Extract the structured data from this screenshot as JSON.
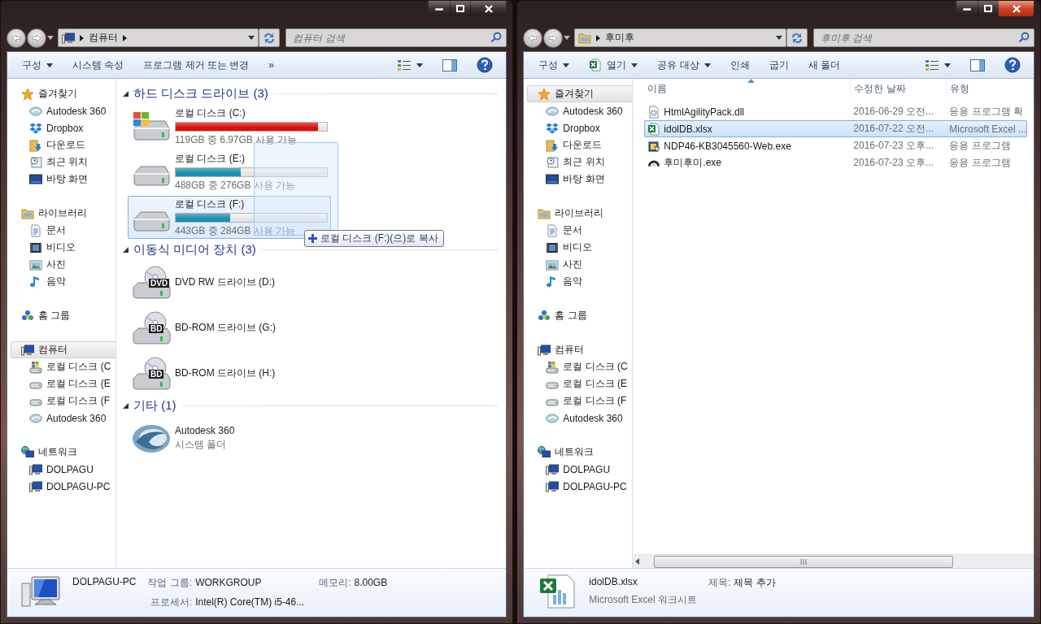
{
  "windows": [
    {
      "active": false,
      "address": {
        "kind": "computer",
        "crumbs": [
          "컴퓨터"
        ],
        "has_more": true
      },
      "search": {
        "placeholder": "컴퓨터 검색"
      },
      "toolbar": [
        {
          "label": "구성",
          "kind": "plain",
          "dropdown": true
        },
        {
          "label": "시스템 속성",
          "kind": "plain",
          "dropdown": false
        },
        {
          "label": "프로그램 제거 또는 변경",
          "kind": "plain",
          "dropdown": false
        },
        {
          "label": "»",
          "kind": "more",
          "dropdown": false
        }
      ],
      "sidebar": [
        {
          "label": "즐겨찾기",
          "kind": "favorites",
          "selected": false,
          "children": [
            {
              "label": "Autodesk 360",
              "kind": "cloud",
              "selected": false
            },
            {
              "label": "Dropbox",
              "kind": "dropbox",
              "selected": false
            },
            {
              "label": "다운로드",
              "kind": "downloads",
              "selected": false
            },
            {
              "label": "최근 위치",
              "kind": "recent",
              "selected": false
            },
            {
              "label": "바탕 화면",
              "kind": "desktop",
              "selected": false
            }
          ]
        },
        {
          "label": "라이브러리",
          "kind": "library",
          "selected": false,
          "children": [
            {
              "label": "문서",
              "kind": "documents",
              "selected": false
            },
            {
              "label": "비디오",
              "kind": "videos",
              "selected": false
            },
            {
              "label": "사진",
              "kind": "pictures",
              "selected": false
            },
            {
              "label": "음악",
              "kind": "music",
              "selected": false
            }
          ]
        },
        {
          "label": "홈 그룹",
          "kind": "homegroup",
          "selected": false
        },
        {
          "label": "컴퓨터",
          "kind": "computer",
          "selected": true,
          "children": [
            {
              "label": "로컬 디스크 (C",
              "kind": "system-drive",
              "selected": false
            },
            {
              "label": "로컬 디스크 (E",
              "kind": "drive",
              "selected": false
            },
            {
              "label": "로컬 디스크 (F",
              "kind": "drive",
              "selected": false
            },
            {
              "label": "Autodesk 360",
              "kind": "cloud",
              "selected": false
            }
          ]
        },
        {
          "label": "네트워크",
          "kind": "network",
          "selected": false,
          "children": [
            {
              "label": "DOLPAGU",
              "kind": "pc",
              "selected": false
            },
            {
              "label": "DOLPAGU-PC",
              "kind": "pc",
              "selected": false
            }
          ]
        }
      ],
      "content": {
        "kind": "drives",
        "drag_tip": "로컬 디스크 (F:)(으)로 복사",
        "groups": [
          {
            "title": "하드 디스크 드라이브 (3)",
            "expanded": true,
            "items": [
              {
                "kind": "system-drive",
                "name": "로컬 디스크 (C:)",
                "level": 0.94,
                "color": "#e00d0d",
                "space": "119GB 중 6.97GB 사용 가능",
                "selected": false
              },
              {
                "kind": "drive",
                "name": "로컬 디스크 (E:)",
                "level": 0.43,
                "color": "#1b8fae",
                "space": "488GB 중 276GB 사용 가능",
                "selected": false
              },
              {
                "kind": "drive",
                "name": "로컬 디스크 (F:)",
                "level": 0.36,
                "color": "#1b8fae",
                "space": "443GB 중 284GB 사용 가능",
                "selected": true
              }
            ]
          },
          {
            "title": "이동식 미디어 장치 (3)",
            "expanded": true,
            "items": [
              {
                "kind": "disc-drive",
                "badge": "DVD",
                "name": "DVD RW 드라이브 (D:)",
                "selected": false
              },
              {
                "kind": "disc-drive",
                "badge": "BD",
                "name": "BD-ROM 드라이브 (G:)",
                "selected": false
              },
              {
                "kind": "disc-drive",
                "badge": "BD",
                "name": "BD-ROM 드라이브 (H:)",
                "selected": false
              }
            ]
          },
          {
            "title": "기타 (1)",
            "expanded": true,
            "items": [
              {
                "kind": "cloud",
                "name": "Autodesk 360",
                "subtitle": "시스템 폴더",
                "selected": false
              }
            ]
          }
        ]
      },
      "details": {
        "kind": "computer",
        "title": "DOLPAGU-PC",
        "fields": [
          {
            "label": "작업 그룹:",
            "value": "WORKGROUP"
          },
          {
            "label": "메모리:",
            "value": "8.00GB"
          },
          {
            "label": "프로세서:",
            "value": "Intel(R) Core(TM) i5-46..."
          }
        ]
      }
    },
    {
      "active": true,
      "address": {
        "kind": "folder",
        "crumbs": [
          "후미후"
        ],
        "has_more": false
      },
      "search": {
        "placeholder": "후미후 검색"
      },
      "toolbar": [
        {
          "label": "구성",
          "kind": "plain",
          "dropdown": true
        },
        {
          "label": "열기",
          "kind": "app",
          "dropdown": true
        },
        {
          "label": "공유 대상",
          "kind": "plain",
          "dropdown": true
        },
        {
          "label": "인쇄",
          "kind": "plain",
          "dropdown": false
        },
        {
          "label": "굽기",
          "kind": "plain",
          "dropdown": false
        },
        {
          "label": "새 폴더",
          "kind": "plain",
          "dropdown": false
        }
      ],
      "sidebar": [
        {
          "label": "즐겨찾기",
          "kind": "favorites",
          "selected": true,
          "children": [
            {
              "label": "Autodesk 360",
              "kind": "cloud",
              "selected": false
            },
            {
              "label": "Dropbox",
              "kind": "dropbox",
              "selected": false
            },
            {
              "label": "다운로드",
              "kind": "downloads",
              "selected": false
            },
            {
              "label": "최근 위치",
              "kind": "recent",
              "selected": false
            },
            {
              "label": "바탕 화면",
              "kind": "desktop",
              "selected": false
            }
          ]
        },
        {
          "label": "라이브러리",
          "kind": "library",
          "selected": false,
          "children": [
            {
              "label": "문서",
              "kind": "documents",
              "selected": false
            },
            {
              "label": "비디오",
              "kind": "videos",
              "selected": false
            },
            {
              "label": "사진",
              "kind": "pictures",
              "selected": false
            },
            {
              "label": "음악",
              "kind": "music",
              "selected": false
            }
          ]
        },
        {
          "label": "홈 그룹",
          "kind": "homegroup",
          "selected": false
        },
        {
          "label": "컴퓨터",
          "kind": "computer",
          "selected": false,
          "children": [
            {
              "label": "로컬 디스크 (C",
              "kind": "system-drive",
              "selected": false
            },
            {
              "label": "로컬 디스크 (E",
              "kind": "drive",
              "selected": false
            },
            {
              "label": "로컬 디스크 (F",
              "kind": "drive",
              "selected": false
            },
            {
              "label": "Autodesk 360",
              "kind": "cloud",
              "selected": false
            }
          ]
        },
        {
          "label": "네트워크",
          "kind": "network",
          "selected": false,
          "children": [
            {
              "label": "DOLPAGU",
              "kind": "pc",
              "selected": false
            },
            {
              "label": "DOLPAGU-PC",
              "kind": "pc",
              "selected": false
            }
          ]
        }
      ],
      "content": {
        "kind": "files",
        "columns": [
          {
            "label": "이름",
            "sorted": true
          },
          {
            "label": "수정한 날짜",
            "sorted": false
          },
          {
            "label": "유형",
            "sorted": false
          }
        ],
        "rows": [
          {
            "kind": "library-file",
            "name": "HtmlAgilityPack.dll",
            "date": "2016-06-29 오전...",
            "type": "응용 프로그램 확",
            "selected": false
          },
          {
            "kind": "spreadsheet",
            "name": "idolDB.xlsx",
            "date": "2016-07-22 오전...",
            "type": "Microsoft Excel ...",
            "selected": true
          },
          {
            "kind": "installer",
            "name": "NDP46-KB3045560-Web.exe",
            "date": "2016-07-23 오후...",
            "type": "응용 프로그램",
            "selected": false
          },
          {
            "kind": "app",
            "name": "후미후미.exe",
            "date": "2016-07-23 오후...",
            "type": "응용 프로그램",
            "selected": false
          }
        ]
      },
      "details": {
        "kind": "spreadsheet",
        "title": "idolDB.xlsx",
        "subtitle": "Microsoft Excel 워크시트",
        "fields": [
          {
            "label": "제목:",
            "value": "제목 추가"
          }
        ]
      }
    }
  ]
}
